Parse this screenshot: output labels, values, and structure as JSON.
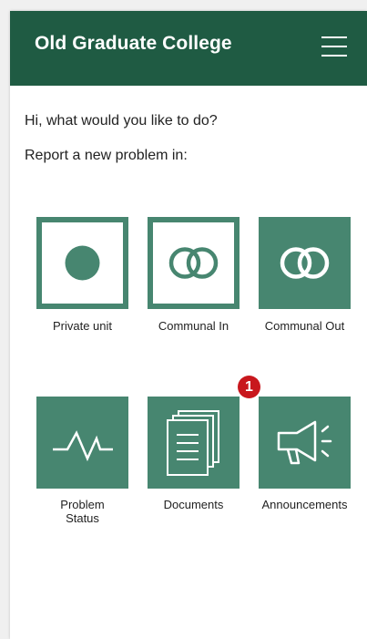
{
  "header": {
    "title": "Old Graduate College",
    "menu_icon": "hamburger-menu-icon"
  },
  "greeting": "Hi, what would you like to do?",
  "subtitle": "Report a new problem in:",
  "tiles": [
    {
      "label": "Private unit",
      "icon": "dot-icon",
      "style": "outline"
    },
    {
      "label": "Communal In",
      "icon": "overlap-circles-icon",
      "style": "outline"
    },
    {
      "label": "Communal Out",
      "icon": "overlap-circles-icon",
      "style": "solid"
    },
    {
      "label_line1": "Problem",
      "label_line2": "Status",
      "icon": "activity-icon",
      "style": "solid"
    },
    {
      "label": "Documents",
      "icon": "documents-icon",
      "style": "solid"
    },
    {
      "label": "Announcements",
      "icon": "megaphone-icon",
      "style": "solid",
      "badge": "1"
    }
  ],
  "colors": {
    "header": "#1f5b43",
    "tile": "#478670",
    "badge": "#c8171d"
  }
}
